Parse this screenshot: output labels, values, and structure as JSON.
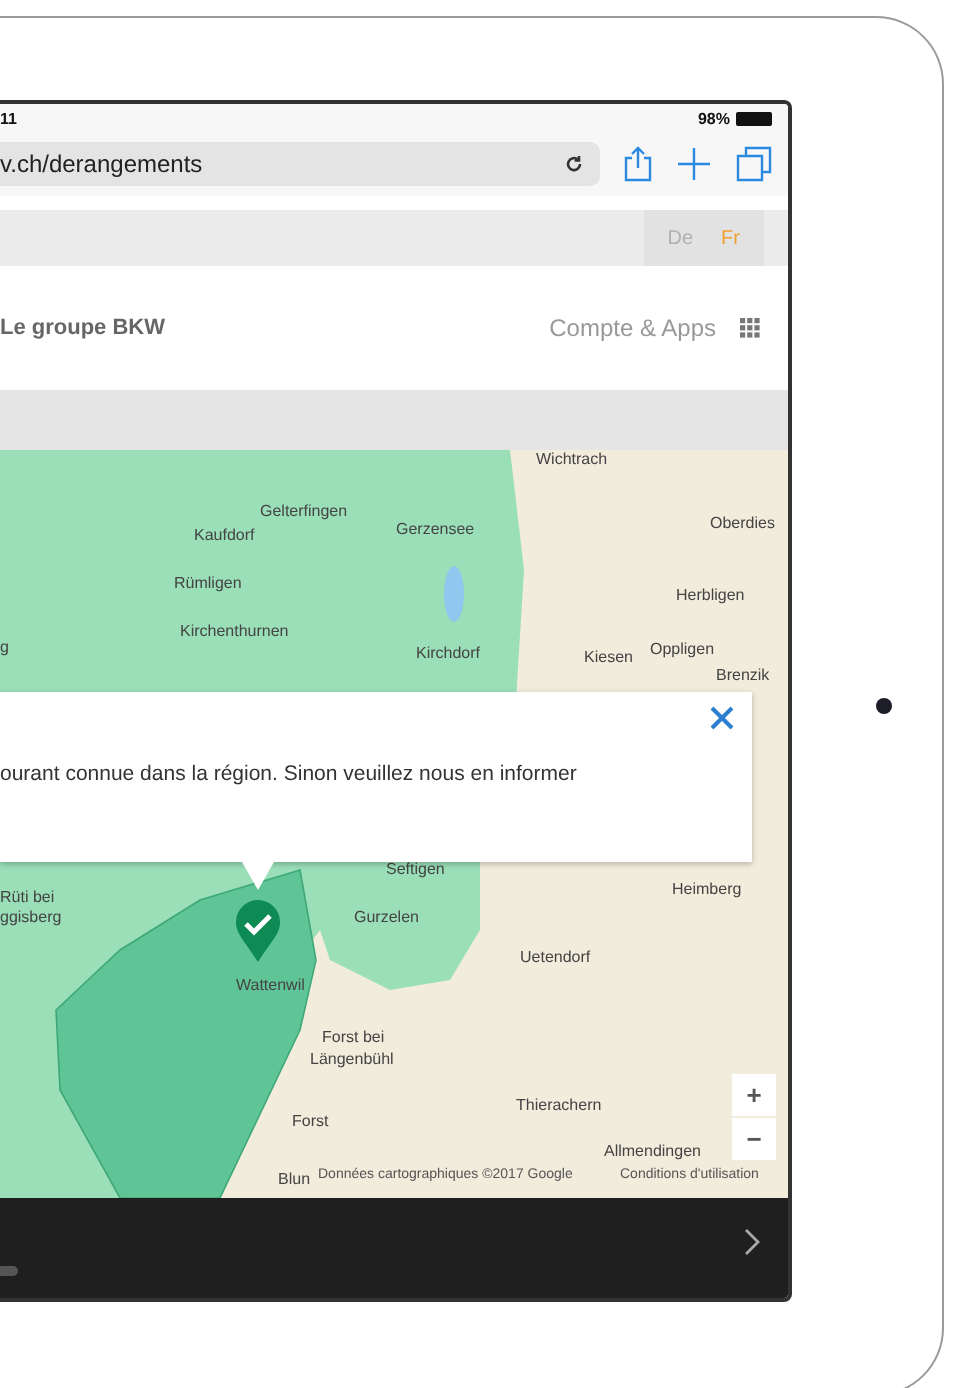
{
  "status_bar": {
    "time": "11",
    "battery": "98%"
  },
  "browser": {
    "url": "v.ch/derangements"
  },
  "languages": [
    {
      "label": "De",
      "selected": false
    },
    {
      "label": "Fr",
      "selected": true
    }
  ],
  "header": {
    "brand": "Le groupe BKW",
    "account": "Compte & Apps"
  },
  "map": {
    "places": [
      "Wichtrach",
      "Gelterfingen",
      "Kaufdorf",
      "Gerzensee",
      "Oberdies",
      "Rümligen",
      "Herbligen",
      "Kirchenthurnen",
      "g",
      "Kirchdorf",
      "Kiesen",
      "Oppligen",
      "Brenzik",
      "Seftigen",
      "Heimberg",
      "Rüti bei",
      "ggisberg",
      "Gurzelen",
      "Uetendorf",
      "Wattenwil",
      "Forst bei",
      "Längenbühl",
      "Thierachern",
      "Forst",
      "Allmendingen",
      "Blun"
    ],
    "attribution": "Données cartographiques ©2017 Google",
    "terms": "Conditions d'utilisation",
    "zoom_in": "+",
    "zoom_out": "−",
    "popup": {
      "text": "ourant connue dans la région. Sinon veuillez nous en informer"
    }
  }
}
